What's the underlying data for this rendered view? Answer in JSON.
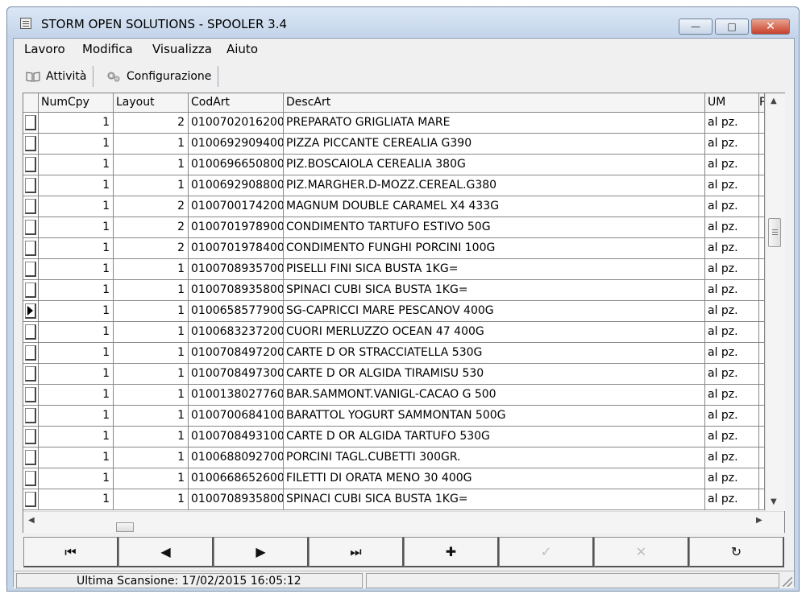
{
  "window": {
    "title": "STORM OPEN SOLUTIONS - SPOOLER 3.4",
    "minimize_glyph": "—",
    "maximize_glyph": "□",
    "close_glyph": "✕"
  },
  "menu": [
    "Lavoro",
    "Modifica",
    "Visualizza",
    "Aiuto"
  ],
  "tabs": [
    {
      "label": "Attività",
      "icon": "book-icon"
    },
    {
      "label": "Configurazione",
      "icon": "gears-icon"
    }
  ],
  "grid": {
    "columns": [
      "NumCpy",
      "Layout",
      "CodArt",
      "DescArt",
      "UM",
      "P"
    ],
    "current_row_index": 9,
    "rows": [
      {
        "numcpy": "1",
        "layout": "2",
        "codart": "0100702016200",
        "descart": "PREPARATO GRIGLIATA MARE",
        "um": "al pz."
      },
      {
        "numcpy": "1",
        "layout": "1",
        "codart": "0100692909400",
        "descart": "PIZZA PICCANTE CEREALIA G390",
        "um": "al pz."
      },
      {
        "numcpy": "1",
        "layout": "1",
        "codart": "0100696650800",
        "descart": "PIZ.BOSCAIOLA CEREALIA 380G",
        "um": "al pz."
      },
      {
        "numcpy": "1",
        "layout": "1",
        "codart": "0100692908800",
        "descart": "PIZ.MARGHER.D-MOZZ.CEREAL.G380",
        "um": "al pz."
      },
      {
        "numcpy": "1",
        "layout": "2",
        "codart": "0100700174200",
        "descart": "MAGNUM DOUBLE CARAMEL X4 433G",
        "um": "al pz."
      },
      {
        "numcpy": "1",
        "layout": "2",
        "codart": "0100701978900",
        "descart": "CONDIMENTO TARTUFO ESTIVO 50G",
        "um": "al pz."
      },
      {
        "numcpy": "1",
        "layout": "2",
        "codart": "0100701978400",
        "descart": "CONDIMENTO FUNGHI PORCINI 100G",
        "um": "al pz."
      },
      {
        "numcpy": "1",
        "layout": "1",
        "codart": "0100708935700",
        "descart": "PISELLI FINI SICA BUSTA 1KG=",
        "um": "al pz."
      },
      {
        "numcpy": "1",
        "layout": "1",
        "codart": "0100708935800",
        "descart": "SPINACI CUBI SICA BUSTA 1KG=",
        "um": "al pz."
      },
      {
        "numcpy": "1",
        "layout": "1",
        "codart": "0100658577900",
        "descart": "SG-CAPRICCI MARE PESCANOV 400G",
        "um": "al pz."
      },
      {
        "numcpy": "1",
        "layout": "1",
        "codart": "0100683237200",
        "descart": "CUORI MERLUZZO OCEAN 47 400G",
        "um": "al pz."
      },
      {
        "numcpy": "1",
        "layout": "1",
        "codart": "0100708497200",
        "descart": "CARTE D OR STRACCIATELLA 530G",
        "um": "al pz."
      },
      {
        "numcpy": "1",
        "layout": "1",
        "codart": "0100708497300",
        "descart": "CARTE D OR ALGIDA TIRAMISU 530",
        "um": "al pz."
      },
      {
        "numcpy": "1",
        "layout": "1",
        "codart": "0100138027760",
        "descart": "BAR.SAMMONT.VANIGL-CACAO G 500",
        "um": "al pz."
      },
      {
        "numcpy": "1",
        "layout": "1",
        "codart": "0100700684100",
        "descart": "BARATTOL YOGURT SAMMONTAN 500G",
        "um": "al pz."
      },
      {
        "numcpy": "1",
        "layout": "1",
        "codart": "0100708493100",
        "descart": "CARTE D OR ALGIDA TARTUFO 530G",
        "um": "al pz."
      },
      {
        "numcpy": "1",
        "layout": "1",
        "codart": "0100688092700",
        "descart": "PORCINI TAGL.CUBETTI 300GR.",
        "um": "al pz."
      },
      {
        "numcpy": "1",
        "layout": "1",
        "codart": "0100668652600",
        "descart": "FILETTI DI ORATA MENO 30  400G",
        "um": "al pz."
      },
      {
        "numcpy": "1",
        "layout": "1",
        "codart": "0100708935800",
        "descart": "SPINACI CUBI SICA BUSTA 1KG=",
        "um": "al pz."
      }
    ]
  },
  "navigator": [
    {
      "name": "first-record-button",
      "glyph": "⏮",
      "enabled": true
    },
    {
      "name": "prior-record-button",
      "glyph": "◀",
      "enabled": true
    },
    {
      "name": "next-record-button",
      "glyph": "▶",
      "enabled": true
    },
    {
      "name": "last-record-button",
      "glyph": "⏭",
      "enabled": true
    },
    {
      "name": "insert-record-button",
      "glyph": "✚",
      "enabled": true
    },
    {
      "name": "post-record-button",
      "glyph": "✓",
      "enabled": false
    },
    {
      "name": "cancel-record-button",
      "glyph": "✕",
      "enabled": false
    },
    {
      "name": "refresh-button",
      "glyph": "↻",
      "enabled": true
    }
  ],
  "status": {
    "last_scan": "Ultima Scansione: 17/02/2015 16:05:12",
    "second_panel": ""
  }
}
